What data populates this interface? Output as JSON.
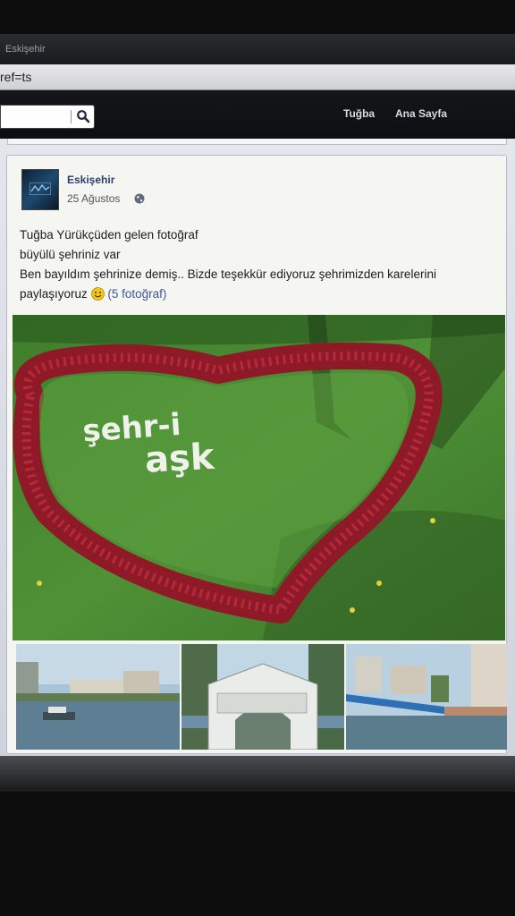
{
  "browser": {
    "tab_title": "Eskişehir",
    "url_fragment": "ref=ts"
  },
  "header": {
    "search_placeholder": "",
    "nav_user": "Tuğba",
    "nav_home": "Ana Sayfa"
  },
  "post": {
    "page_name": "Eskişehir",
    "date": "25 Ağustos",
    "lines": [
      "Tuğba Yürükçüden gelen fotoğraf",
      "büyülü şehriniz var",
      "Ben bayıldım şehrinize demiş.. Bizde teşekkür ediyoruz şehrimizden karelerini",
      "paylaşıyoruz"
    ],
    "photo_link": "(5 fotoğraf)",
    "main_photo_text_line1": "şehr-i",
    "main_photo_text_line2": "aşk",
    "icons": {
      "search": "search-icon",
      "globe": "globe-icon",
      "smiley": "smiley-icon"
    }
  },
  "colors": {
    "link": "#3b5998",
    "header_bg": "#111214",
    "heart_flowers": "#9b1e2c",
    "grass": "#4a8a33"
  }
}
